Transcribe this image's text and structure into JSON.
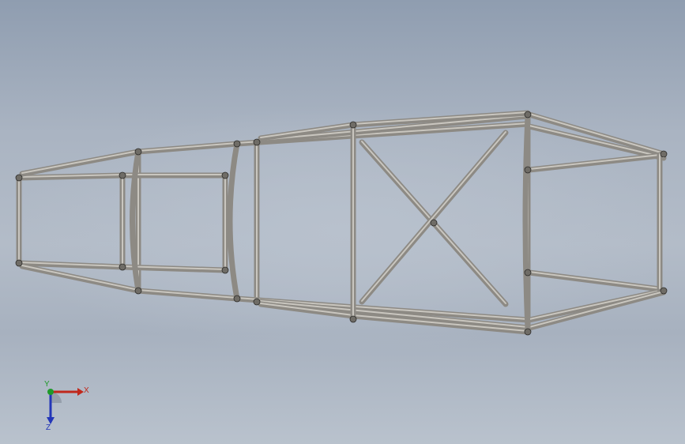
{
  "viewport": {
    "model": "tube-frame-chassis",
    "background_color": "#aab4c2",
    "tube_color": "#8d8a84",
    "tube_highlight": "#c9c6bf"
  },
  "triad": {
    "x_label": "X",
    "y_label": "Y",
    "z_label": "Z",
    "x_color": "#c0281c",
    "y_color": "#1f9a2a",
    "z_color": "#2336b8"
  }
}
